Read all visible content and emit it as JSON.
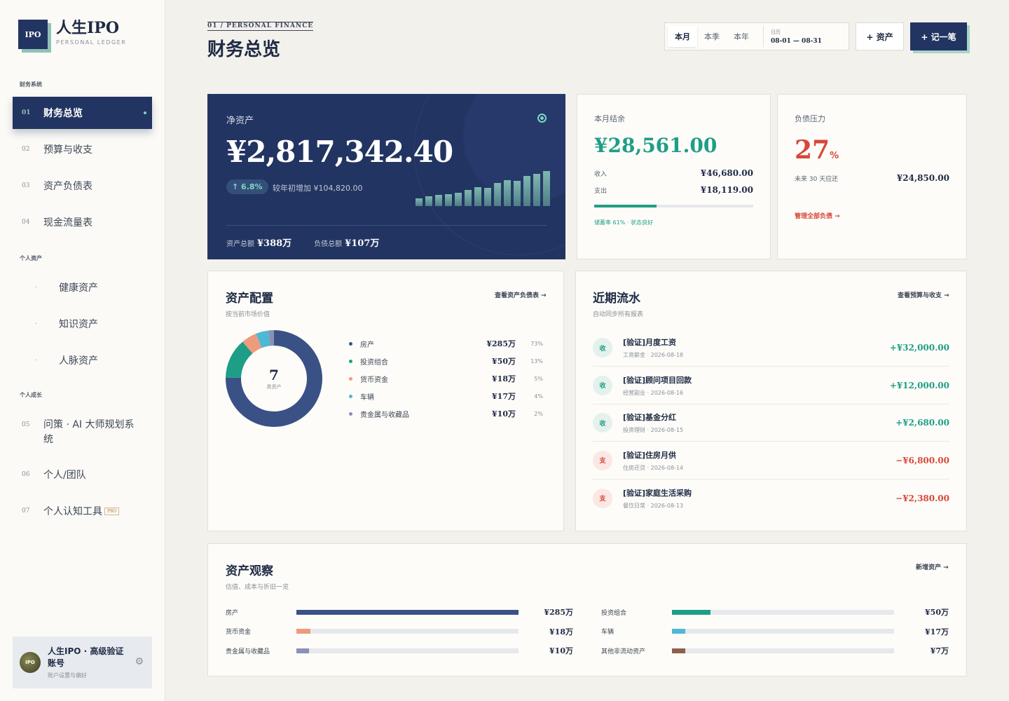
{
  "brand": {
    "logo_text": "IPO",
    "title": "人生IPO",
    "subtitle": "PERSONAL LEDGER"
  },
  "sidebar": {
    "sections": [
      "财务系统",
      "个人资产",
      "个人成长"
    ],
    "items": [
      {
        "num": "01",
        "label": "财务总览"
      },
      {
        "num": "02",
        "label": "预算与收支"
      },
      {
        "num": "03",
        "label": "资产负债表"
      },
      {
        "num": "04",
        "label": "现金流量表"
      },
      {
        "num": "05",
        "label": "问策 · AI 大师规划系统"
      },
      {
        "num": "06",
        "label": "个人/团队"
      },
      {
        "num": "07",
        "label": "个人认知工具",
        "badge": "PRO"
      }
    ],
    "sub_items": [
      "健康资产",
      "知识资产",
      "人脉资产"
    ],
    "sub_bullet": "·",
    "account": {
      "avatar": "IPO",
      "name": "人生IPO · 高级验证账号",
      "sub": "账户设置与偏好",
      "gear_icon": "gear-icon"
    }
  },
  "header": {
    "eyebrow": "01 / PERSONAL FINANCE",
    "title": "财务总览",
    "period_tabs": [
      "本月",
      "本季",
      "本年"
    ],
    "date_label": "日历",
    "date_value": "08-01 — 08-31",
    "asset_button": "+ 资产",
    "record_button": "+ 记一笔"
  },
  "net_worth": {
    "label": "净资产",
    "value": "¥2,817,342.40",
    "change_pct": "↑ 6.8%",
    "change_text": "较年初增加 ¥104,820.00",
    "assets_label": "资产总额",
    "assets_value": "¥388万",
    "debt_label": "负债总额",
    "debt_value": "¥107万",
    "trend": [
      0.22,
      0.26,
      0.3,
      0.32,
      0.36,
      0.44,
      0.52,
      0.5,
      0.64,
      0.72,
      0.7,
      0.82,
      0.88,
      0.96
    ]
  },
  "balance": {
    "label": "本月结余",
    "value": "¥28,561.00",
    "income_label": "收入",
    "income_value": "¥46,680.00",
    "expense_label": "支出",
    "expense_value": "¥18,119.00",
    "savings_rate": 0.39,
    "note": "储蓄率 61% · 状态良好",
    "color": "#1e9e86"
  },
  "debt": {
    "label": "负债压力",
    "value": "27",
    "unit": "%",
    "due_label": "未来 30 天应还",
    "due_value": "¥24,850.00",
    "link": "管理全部负债 →",
    "color": "#d8473a"
  },
  "allocation": {
    "title": "资产配置",
    "subtitle": "按当前市场价值",
    "link": "查看资产负债表 →",
    "center_value": "7",
    "center_label": "类资产",
    "items": [
      {
        "name": "房产",
        "value": "¥285万",
        "pct": "73%",
        "share": 73,
        "color": "#3a5186"
      },
      {
        "name": "投资组合",
        "value": "¥50万",
        "pct": "13%",
        "share": 13,
        "color": "#1e9e86"
      },
      {
        "name": "货币资金",
        "value": "¥18万",
        "pct": "5%",
        "share": 5,
        "color": "#ee9a7c"
      },
      {
        "name": "车辆",
        "value": "¥17万",
        "pct": "4%",
        "share": 4,
        "color": "#4fb8d4"
      },
      {
        "name": "贵金属与收藏品",
        "value": "¥10万",
        "pct": "2%",
        "share": 2,
        "color": "#8891b8"
      }
    ]
  },
  "transactions": {
    "title": "近期流水",
    "subtitle": "自动同步所有报表",
    "link": "查看预算与收支 →",
    "items": [
      {
        "type": "in",
        "icon": "收",
        "name": "[验证]月度工资",
        "meta": "工资薪金 · 2026-08-18",
        "amount": "+¥32,000.00"
      },
      {
        "type": "in",
        "icon": "收",
        "name": "[验证]顾问项目回款",
        "meta": "经营副业 · 2026-08-16",
        "amount": "+¥12,000.00"
      },
      {
        "type": "in",
        "icon": "收",
        "name": "[验证]基金分红",
        "meta": "投资理财 · 2026-08-15",
        "amount": "+¥2,680.00"
      },
      {
        "type": "out",
        "icon": "支",
        "name": "[验证]住房月供",
        "meta": "住房还贷 · 2026-08-14",
        "amount": "−¥6,800.00"
      },
      {
        "type": "out",
        "icon": "支",
        "name": "[验证]家庭生活采购",
        "meta": "餐饮日常 · 2026-08-13",
        "amount": "−¥2,380.00"
      }
    ]
  },
  "observation": {
    "title": "资产观察",
    "subtitle": "估值、成本与折旧一览",
    "link": "新增资产 →",
    "items": [
      {
        "name": "房产",
        "value": "¥285万",
        "level": 1.0,
        "color": "#3a5186"
      },
      {
        "name": "投资组合",
        "value": "¥50万",
        "level": 0.175,
        "color": "#1e9e86"
      },
      {
        "name": "货币资金",
        "value": "¥18万",
        "level": 0.063,
        "color": "#ee9a7c"
      },
      {
        "name": "车辆",
        "value": "¥17万",
        "level": 0.06,
        "color": "#4fb8d4"
      },
      {
        "name": "贵金属与收藏品",
        "value": "¥10万",
        "level": 0.056,
        "color": "#8891b8"
      },
      {
        "name": "其他非流动资产",
        "value": "¥7万",
        "level": 0.06,
        "color": "#8b6149"
      }
    ]
  }
}
